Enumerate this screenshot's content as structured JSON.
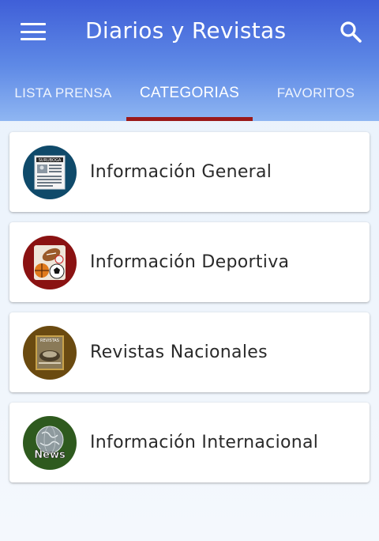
{
  "app": {
    "title": "Diarios y Revistas"
  },
  "tabs": [
    {
      "label": "LISTA PRENSA",
      "active": false
    },
    {
      "label": "CATEGORIAS",
      "active": true
    },
    {
      "label": "FAVORITOS",
      "active": false
    }
  ],
  "categories": [
    {
      "label": "Información General",
      "icon": "newspaper-icon",
      "bg": "#0f4a6a"
    },
    {
      "label": "Información Deportiva",
      "icon": "sports-balls-icon",
      "bg": "#8a1212"
    },
    {
      "label": "Revistas Nacionales",
      "icon": "magazine-icon",
      "bg": "#6a4a10"
    },
    {
      "label": "Información Internacional",
      "icon": "globe-news-icon",
      "bg": "#2e5a1e"
    }
  ],
  "colors": {
    "appbar": "#4a6ee0",
    "tab_indicator": "#9b1a1a",
    "background": "#eaf2fb"
  },
  "icon_text": {
    "newspaper_masthead": "SURUBOGA",
    "magazine_masthead": "REVISTAS",
    "news_badge": "News"
  }
}
